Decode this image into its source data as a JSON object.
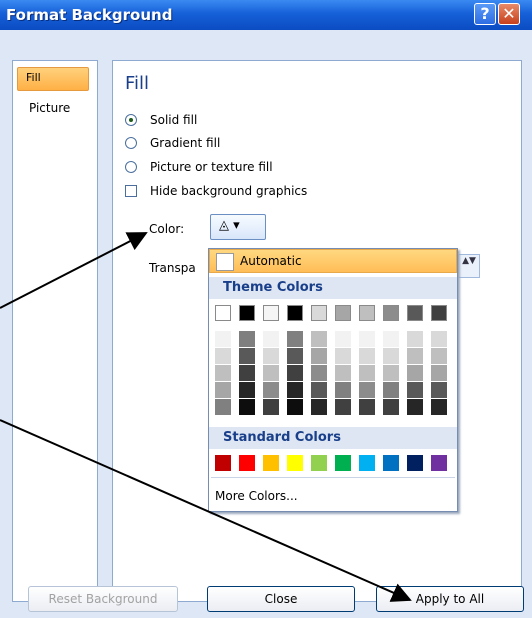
{
  "window": {
    "title": "Format Background",
    "help_glyph": "?",
    "close_glyph": "✕"
  },
  "nav": {
    "items": [
      "Fill",
      "Picture"
    ]
  },
  "fill": {
    "heading": "Fill",
    "options": [
      {
        "label": "Solid fill",
        "type": "radio",
        "selected": true
      },
      {
        "label": "Gradient fill",
        "type": "radio",
        "selected": false
      },
      {
        "label": "Picture or texture fill",
        "type": "radio",
        "selected": false
      },
      {
        "label": "Hide background graphics",
        "type": "checkbox",
        "checked": false
      }
    ],
    "color_label": "Color:",
    "color_button_glyph": "◬ ▾",
    "transparency_label": "Transpa",
    "spinner_glyph": "▲▼"
  },
  "color_dropdown": {
    "automatic_label": "Automatic",
    "theme_heading": "Theme Colors",
    "theme_colors": [
      "#ffffff",
      "#000000",
      "#f5f5f5",
      "#000000",
      "#d9d9d9",
      "#a6a6a6",
      "#bfbfbf",
      "#8c8c8c",
      "#595959",
      "#404040"
    ],
    "theme_shades": [
      [
        "#f2f2f2",
        "#d9d9d9",
        "#bfbfbf",
        "#a6a6a6",
        "#808080"
      ],
      [
        "#7f7f7f",
        "#595959",
        "#404040",
        "#262626",
        "#0d0d0d"
      ],
      [
        "#f2f2f2",
        "#d9d9d9",
        "#bfbfbf",
        "#8c8c8c",
        "#3f3f3f"
      ],
      [
        "#808080",
        "#595959",
        "#404040",
        "#262626",
        "#0d0d0d"
      ],
      [
        "#bfbfbf",
        "#a6a6a6",
        "#8c8c8c",
        "#595959",
        "#262626"
      ],
      [
        "#f2f2f2",
        "#d9d9d9",
        "#bfbfbf",
        "#808080",
        "#404040"
      ],
      [
        "#f2f2f2",
        "#d9d9d9",
        "#bfbfbf",
        "#8c8c8c",
        "#404040"
      ],
      [
        "#f2f2f2",
        "#d9d9d9",
        "#bfbfbf",
        "#808080",
        "#404040"
      ],
      [
        "#d9d9d9",
        "#bfbfbf",
        "#a6a6a6",
        "#595959",
        "#262626"
      ],
      [
        "#d9d9d9",
        "#bfbfbf",
        "#a6a6a6",
        "#595959",
        "#262626"
      ]
    ],
    "standard_heading": "Standard Colors",
    "standard_colors": [
      "#c00000",
      "#ff0000",
      "#ffc000",
      "#ffff00",
      "#92d050",
      "#00b050",
      "#00b0f0",
      "#0070c0",
      "#002060",
      "#7030a0"
    ],
    "more_colors_label": "More Colors..."
  },
  "buttons": {
    "reset_background": "Reset Background",
    "close": "Close",
    "apply_to_all": "Apply to All"
  }
}
